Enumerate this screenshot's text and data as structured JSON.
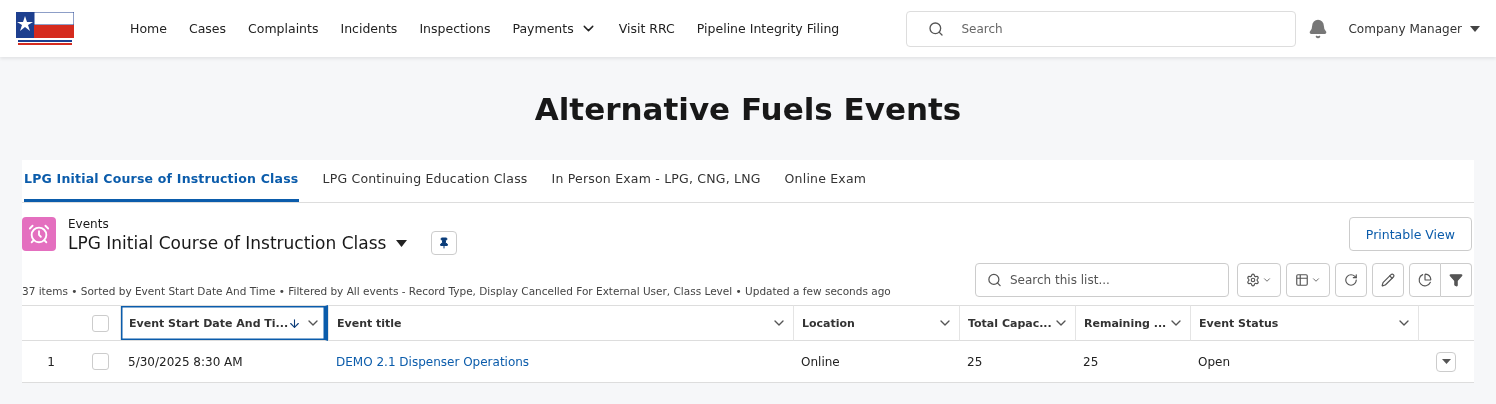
{
  "nav": {
    "items": [
      {
        "label": "Home",
        "dropdown": false
      },
      {
        "label": "Cases",
        "dropdown": false
      },
      {
        "label": "Complaints",
        "dropdown": false
      },
      {
        "label": "Incidents",
        "dropdown": false
      },
      {
        "label": "Inspections",
        "dropdown": false
      },
      {
        "label": "Payments",
        "dropdown": true
      },
      {
        "label": "Visit RRC",
        "dropdown": false
      },
      {
        "label": "Pipeline Integrity Filing",
        "dropdown": false
      }
    ],
    "search": {
      "placeholder": "Search"
    },
    "user": "Company Manager"
  },
  "page_title": "Alternative Fuels Events",
  "tabs": [
    {
      "label": "LPG Initial Course of Instruction Class",
      "selected": true
    },
    {
      "label": "LPG Continuing Education Class",
      "selected": false
    },
    {
      "label": "In Person Exam - LPG, CNG, LNG",
      "selected": false
    },
    {
      "label": "Online Exam",
      "selected": false
    }
  ],
  "list_view": {
    "object": "Events",
    "name": "LPG Initial Course of Instruction Class",
    "printable_button": "Printable View",
    "summary": "37 items • Sorted by Event Start Date And Time • Filtered by All events - Record Type, Display Cancelled For External User, Class Level • Updated a few seconds ago",
    "search_placeholder": "Search this list..."
  },
  "table": {
    "select_all_checked": false,
    "columns": [
      {
        "label": "Event Start Date And Ti...",
        "sorted": true
      },
      {
        "label": "Event title",
        "sorted": false
      },
      {
        "label": "Location",
        "sorted": false
      },
      {
        "label": "Total Capac...",
        "sorted": false
      },
      {
        "label": "Remaining ...",
        "sorted": false
      },
      {
        "label": "Event Status",
        "sorted": false
      }
    ],
    "rows": [
      {
        "number": "1",
        "checked": false,
        "cells": [
          "5/30/2025 8:30 AM",
          "DEMO 2.1 Dispenser Operations",
          "Online",
          "25",
          "25",
          "Open"
        ]
      }
    ]
  }
}
